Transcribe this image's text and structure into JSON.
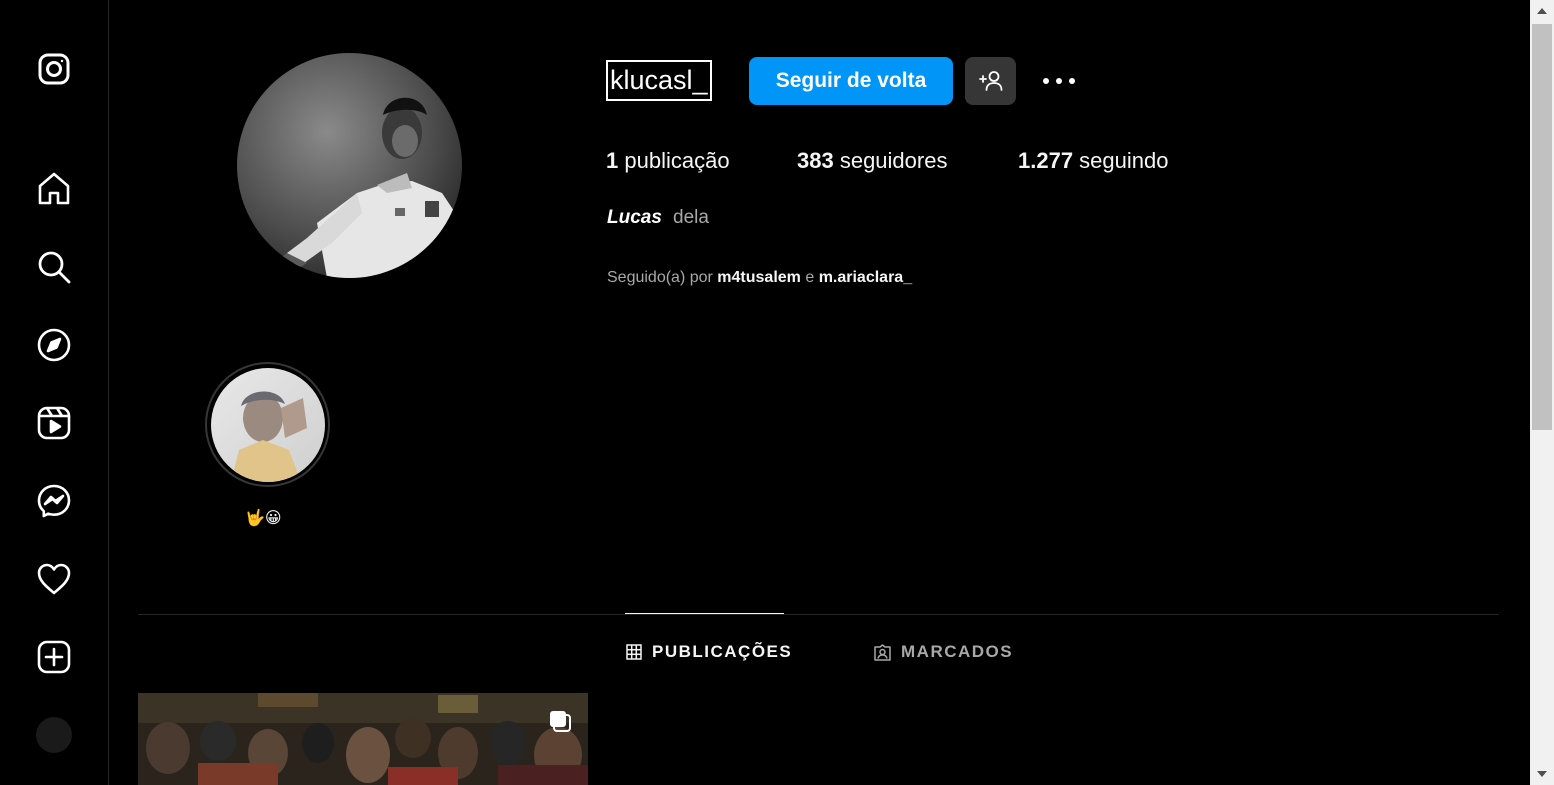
{
  "sidebar": {
    "items": [
      {
        "name": "instagram-logo-icon"
      },
      {
        "name": "home-icon"
      },
      {
        "name": "search-icon"
      },
      {
        "name": "explore-icon"
      },
      {
        "name": "reels-icon"
      },
      {
        "name": "messenger-icon"
      },
      {
        "name": "notifications-heart-icon"
      },
      {
        "name": "create-icon"
      },
      {
        "name": "profile-avatar"
      }
    ]
  },
  "profile": {
    "username": "klucasl_",
    "follow_back_label": "Seguir de volta",
    "stats": {
      "posts_count": "1",
      "posts_label": " publicação",
      "followers_count": "383",
      "followers_label": " seguidores",
      "following_count": "1.277",
      "following_label": " seguindo"
    },
    "full_name": "Lucas",
    "pronouns": "dela",
    "followed_by": {
      "prefix": "Seguido(a) por ",
      "user1": "m4tusalem",
      "conjunction": " e ",
      "user2": "m.ariaclara_"
    }
  },
  "highlights": [
    {
      "label": "🤟😀"
    }
  ],
  "tabs": [
    {
      "label": "PUBLICAÇÕES",
      "active": true
    },
    {
      "label": "MARCADOS",
      "active": false
    }
  ],
  "colors": {
    "accent": "#0095f6",
    "background": "#000000",
    "secondary_button": "#363636",
    "muted_text": "#a8a8a8"
  }
}
